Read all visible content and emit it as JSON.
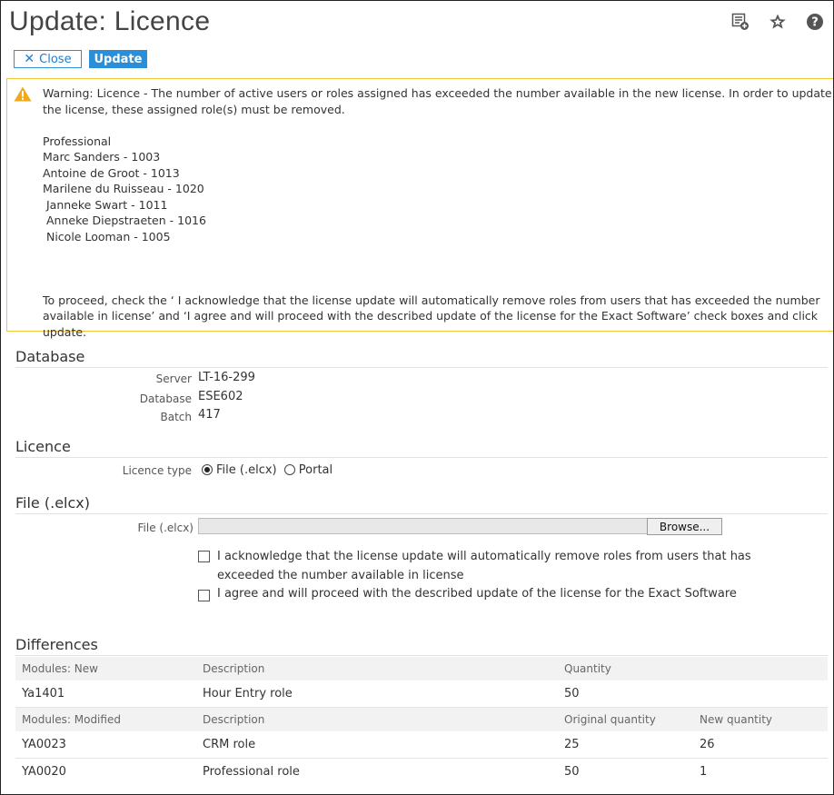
{
  "page": {
    "title": "Update: Licence"
  },
  "toolbar": {
    "close_label": "Close",
    "update_label": "Update"
  },
  "top_icons": [
    "add-to-menu-icon",
    "star-icon",
    "help-icon"
  ],
  "warning": {
    "icon": "warning-icon",
    "text": "Warning: Licence - The number of active users or roles assigned has exceeded the number available in the new license. In order to update the license, these assigned role(s) must be removed.\n\nProfessional\nMarc Sanders - 1003\nAntoine de Groot - 1013\nMarilene du Ruisseau - 1020\n Janneke Swart - 1011\n Anneke Diepstraeten - 1016\n Nicole Looman - 1005\n\n\n\nTo proceed, check the ‘ I acknowledge that the license update will automatically remove roles from users that has exceeded the number available in license’ and ‘I agree and will proceed with the described update of the license for the Exact Software’ check boxes and click update."
  },
  "database": {
    "heading": "Database",
    "server_label": "Server",
    "server_value": "LT-16-299",
    "database_label": "Database",
    "database_value": "ESE602",
    "batch_label": "Batch",
    "batch_value": "417"
  },
  "licence": {
    "heading": "Licence",
    "type_label": "Licence type",
    "option_file": "File (.elcx)",
    "option_portal": "Portal",
    "selected": "File (.elcx)"
  },
  "file": {
    "heading": "File (.elcx)",
    "field_label": "File (.elcx)",
    "field_value": "",
    "browse_label": "Browse...",
    "ack_label": "I acknowledge that the license update will automatically remove roles from users that has exceeded the number available in license",
    "agree_label": "I agree and will proceed with the described update of the license for the Exact Software",
    "ack_checked": false,
    "agree_checked": false
  },
  "differences": {
    "heading": "Differences",
    "new": {
      "headers": [
        "Modules: New",
        "Description",
        "Quantity"
      ],
      "rows": [
        [
          "Ya1401",
          "Hour Entry role",
          "50"
        ]
      ]
    },
    "modified": {
      "headers": [
        "Modules: Modified",
        "Description",
        "Original quantity",
        "New quantity"
      ],
      "rows": [
        [
          "YA0023",
          "CRM role",
          "25",
          "26"
        ],
        [
          "YA0020",
          "Professional role",
          "50",
          "1"
        ]
      ]
    }
  },
  "colors": {
    "accent": "#2a8fd8",
    "warning_border": "#f0c53a",
    "warning_icon": "#f0a81c"
  }
}
